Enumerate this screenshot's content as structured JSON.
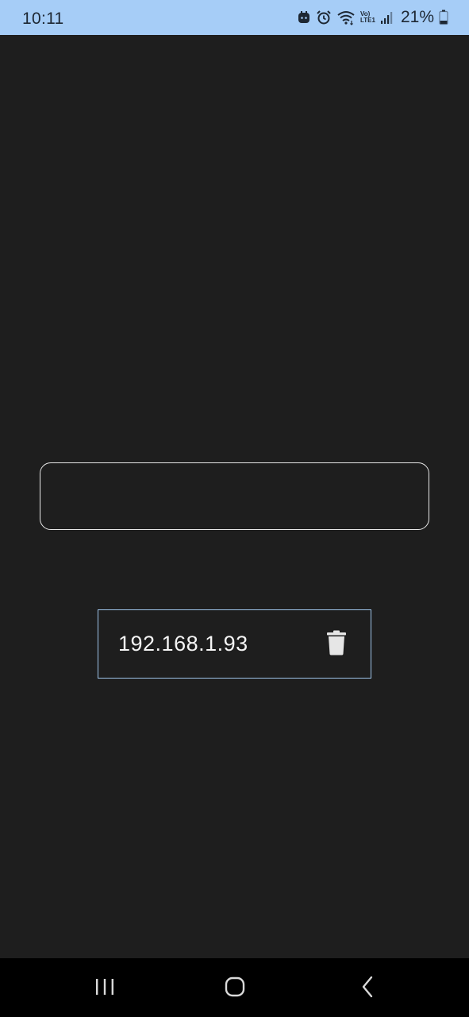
{
  "status_bar": {
    "time": "10:11",
    "battery_percent": "21%",
    "network": "Vo) LTE1",
    "background_color": "#a6cdf7"
  },
  "input": {
    "value": "",
    "placeholder": ""
  },
  "saved_ips": [
    {
      "address": "192.168.1.93",
      "action_icon": "trash-icon"
    }
  ],
  "nav_bar": {
    "buttons": [
      "recent-apps-icon",
      "home-icon",
      "back-icon"
    ]
  },
  "colors": {
    "background": "#1e1e1e",
    "input_border": "#e8e8e8",
    "item_border": "#9ec4ea"
  }
}
